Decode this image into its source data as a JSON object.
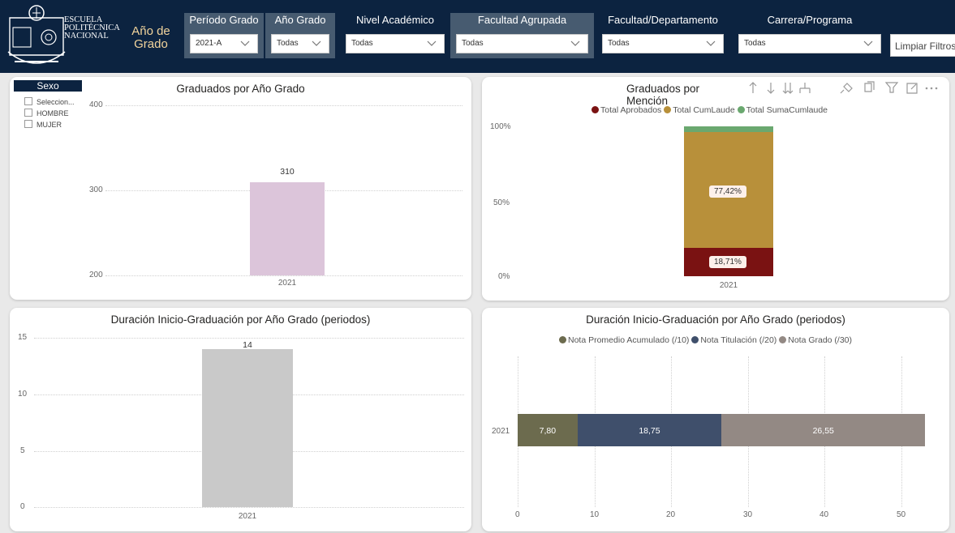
{
  "header": {
    "logo_lines": [
      "ESCUELA",
      "POLITÉCNICA",
      "NACIONAL"
    ],
    "title_line1": "Año de",
    "title_line2": "Grado",
    "filters": [
      {
        "label": "Período Grado",
        "value": "2021-A"
      },
      {
        "label": "Año Grado",
        "value": "Todas"
      },
      {
        "label": "Nivel Académico",
        "value": "Todas"
      },
      {
        "label": "Facultad Agrupada",
        "value": "Todas"
      },
      {
        "label": "Facultad/Departamento",
        "value": "Todas"
      },
      {
        "label": "Carrera/Programa",
        "value": "Todas"
      }
    ],
    "clear_button": "Limpiar Filtros"
  },
  "sexo_slicer": {
    "title": "Sexo",
    "items": [
      "Seleccion...",
      "HOMBRE",
      "MUJER"
    ]
  },
  "toolbar_icons": [
    "sort-asc-icon",
    "sort-desc-icon",
    "drill-down-icon",
    "expand-hierarchy-icon",
    "pin-icon",
    "copy-icon",
    "filter-icon",
    "focus-mode-icon",
    "more-options-icon"
  ],
  "colors": {
    "header_bg": "#0c2340",
    "title_gold": "#f2d49c",
    "aprobados": "#7a1212",
    "cumlaude": "#b8903a",
    "sumacumlaude": "#6aa86f",
    "nota_promedio": "#6c6b4e",
    "nota_titulacion": "#3f4f6b",
    "nota_grado": "#938984",
    "graduados_bar": "#dcc5da",
    "duracion_bar": "#c9c9c9"
  },
  "chart_data": [
    {
      "type": "bar",
      "title": "Graduados por Año Grado",
      "categories": [
        "2021"
      ],
      "values": [
        310
      ],
      "data_labels": [
        "310"
      ],
      "y_ticks": [
        "400",
        "300",
        "200"
      ],
      "ylim": [
        200,
        400
      ],
      "grid": true
    },
    {
      "type": "bar",
      "stacked": "percent",
      "title": "Graduados por Mención",
      "categories": [
        "2021"
      ],
      "series": [
        {
          "name": "Total Aprobados",
          "values": [
            18.71
          ],
          "label": "18,71%"
        },
        {
          "name": "Total CumLaude",
          "values": [
            77.42
          ],
          "label": "77,42%"
        },
        {
          "name": "Total SumaCumlaude",
          "values": [
            3.87
          ]
        }
      ],
      "y_ticks": [
        "100%",
        "50%",
        "0%"
      ],
      "ylim": [
        0,
        100
      ],
      "legend": "top-center"
    },
    {
      "type": "bar",
      "title": "Duración Inicio-Graduación por Año Grado (periodos)",
      "categories": [
        "2021"
      ],
      "values": [
        14
      ],
      "data_labels": [
        "14"
      ],
      "y_ticks": [
        "15",
        "10",
        "5",
        "0"
      ],
      "ylim": [
        0,
        15
      ],
      "grid": true
    },
    {
      "type": "bar",
      "orientation": "horizontal",
      "stacked": true,
      "title": "Duración Inicio-Graduación por Año Grado (periodos)",
      "categories": [
        "2021"
      ],
      "series": [
        {
          "name": "Nota Promedio Acumulado (/10)",
          "values": [
            7.8
          ],
          "label": "7,80"
        },
        {
          "name": "Nota Titulación (/20)",
          "values": [
            18.75
          ],
          "label": "18,75"
        },
        {
          "name": "Nota Grado (/30)",
          "values": [
            26.55
          ],
          "label": "26,55"
        }
      ],
      "x_ticks": [
        "0",
        "10",
        "20",
        "30",
        "40",
        "50"
      ],
      "xlim": [
        0,
        55
      ],
      "legend": "top-center"
    }
  ]
}
